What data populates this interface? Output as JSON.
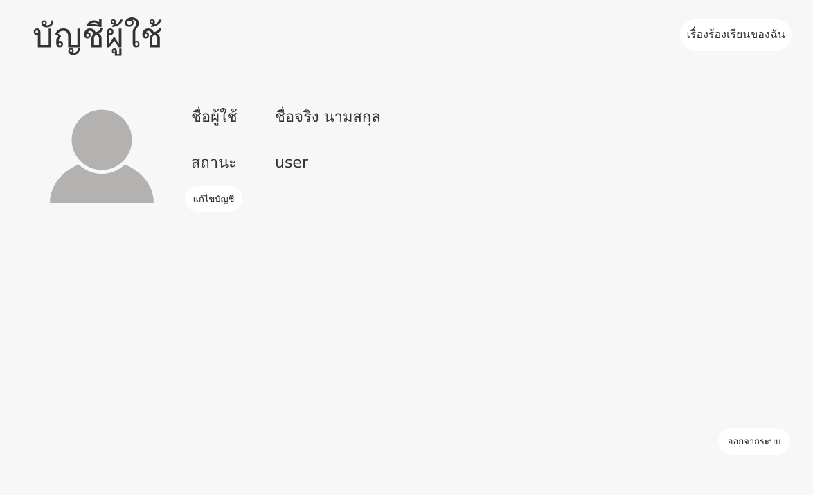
{
  "header": {
    "title": "บัญชีผู้ใช้",
    "complaints_link": "เรื่องร้องเรียนของฉัน"
  },
  "profile": {
    "avatar_icon": "user-silhouette-icon",
    "username_label": "ชื่อผู้ใช้",
    "username_value": "ชื่อจริง นามสกุล",
    "status_label": "สถานะ",
    "status_value": "user",
    "edit_button": "แก้ไขบัญชี"
  },
  "footer": {
    "logout_button": "ออกจากระบบ"
  },
  "colors": {
    "background": "#f7f7f7",
    "pill_background": "#ffffff",
    "text": "#333333",
    "avatar": "#b3b2b0"
  }
}
